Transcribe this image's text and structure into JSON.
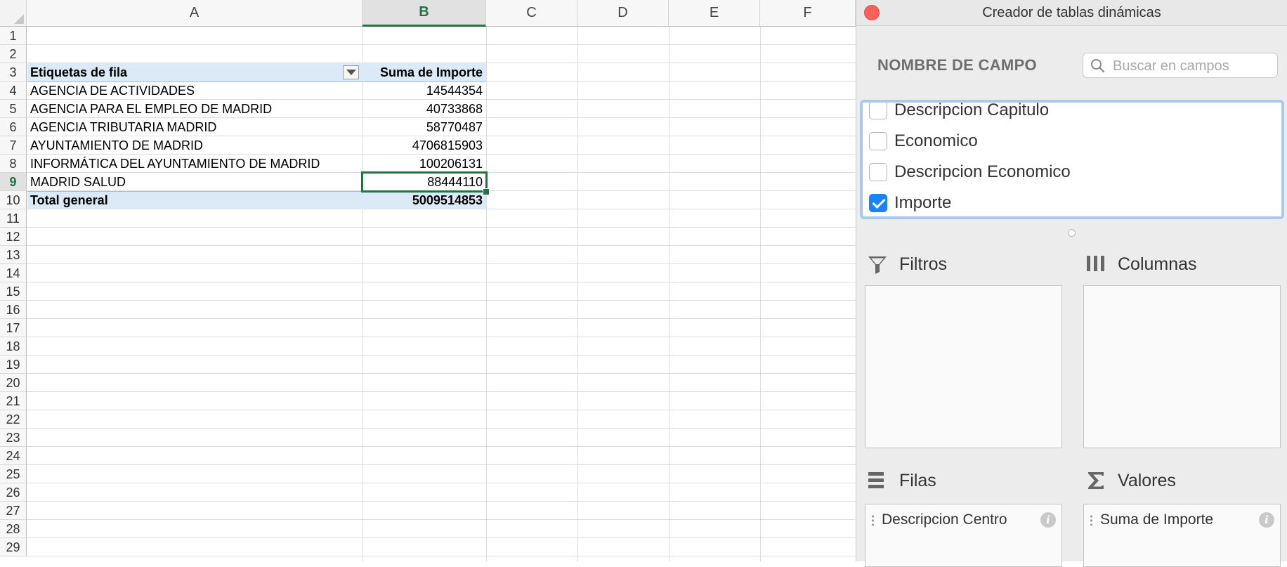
{
  "sheet": {
    "columns": [
      "A",
      "B",
      "C",
      "D",
      "E",
      "F"
    ],
    "rows": [
      "1",
      "2",
      "3",
      "4",
      "5",
      "6",
      "7",
      "8",
      "9",
      "10",
      "11",
      "12",
      "13",
      "14",
      "15",
      "16",
      "17",
      "18",
      "19",
      "20",
      "21",
      "22",
      "23",
      "24",
      "25",
      "26",
      "27",
      "28",
      "29"
    ],
    "selected_column": "B",
    "selected_row": "9",
    "pivot": {
      "header_label": "Etiquetas de fila",
      "header_value": "Suma de Importe",
      "entries": [
        {
          "label": "AGENCIA DE ACTIVIDADES",
          "value": "14544354"
        },
        {
          "label": "AGENCIA PARA EL EMPLEO DE MADRID",
          "value": "40733868"
        },
        {
          "label": "AGENCIA TRIBUTARIA MADRID",
          "value": "58770487"
        },
        {
          "label": "AYUNTAMIENTO DE MADRID",
          "value": "4706815903"
        },
        {
          "label": "INFORMÁTICA DEL AYUNTAMIENTO DE MADRID",
          "value": "100206131"
        },
        {
          "label": "MADRID SALUD",
          "value": "88444110"
        }
      ],
      "total_label": "Total general",
      "total_value": "5009514853"
    }
  },
  "pane": {
    "title": "Creador de tablas dinámicas",
    "field_name_title": "NOMBRE DE CAMPO",
    "search_placeholder": "Buscar en campos",
    "fields": [
      {
        "label": "Descripcion Capitulo",
        "checked": false
      },
      {
        "label": "Economico",
        "checked": false
      },
      {
        "label": "Descripcion Economico",
        "checked": false
      },
      {
        "label": "Importe",
        "checked": true
      }
    ],
    "areas": {
      "filters": {
        "label": "Filtros",
        "icon": "funnel-icon"
      },
      "columns": {
        "label": "Columnas",
        "icon": "columns-icon"
      },
      "rows": {
        "label": "Filas",
        "icon": "rows-icon",
        "items": [
          "Descripcion Centro"
        ]
      },
      "values": {
        "label": "Valores",
        "icon": "sigma-icon",
        "items": [
          "Suma de Importe"
        ]
      }
    }
  },
  "colors": {
    "accent_green": "#217346",
    "pivot_band": "#dce9f6",
    "checkbox_blue": "#1a82fb",
    "close_red": "#fc605b"
  }
}
